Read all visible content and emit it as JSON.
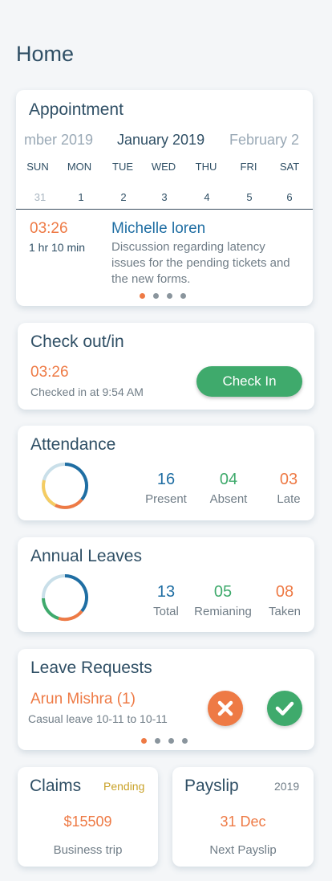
{
  "page": {
    "title": "Home"
  },
  "appointment": {
    "title": "Appointment",
    "months": {
      "prev": "mber 2019",
      "current": "January 2019",
      "next": "February 2"
    },
    "weekdays": [
      "SUN",
      "MON",
      "TUE",
      "WED",
      "THU",
      "FRI",
      "SAT"
    ],
    "dates": [
      "31",
      "1",
      "2",
      "3",
      "4",
      "5",
      "6"
    ],
    "time": "03:26",
    "duration": "1 hr 10 min",
    "person": "Michelle loren",
    "description": "Discussion regarding latency issues for the pending tickets and the new forms.",
    "pager": {
      "count": 4,
      "active": 0
    }
  },
  "checkin": {
    "title": "Check out/in",
    "time": "03:26",
    "subtitle": "Checked in at 9:54 AM",
    "button_label": "Check In"
  },
  "attendance": {
    "title": "Attendance",
    "stats": [
      {
        "value": "16",
        "label": "Present",
        "color": "#1f6ea3"
      },
      {
        "value": "04",
        "label": "Absent",
        "color": "#3faa6c"
      },
      {
        "value": "03",
        "label": "Late",
        "color": "#ee7a45"
      }
    ]
  },
  "annual_leaves": {
    "title": "Annual Leaves",
    "stats": [
      {
        "value": "13",
        "label": "Total",
        "color": "#1f6ea3"
      },
      {
        "value": "05",
        "label": "Remianing",
        "color": "#3faa6c"
      },
      {
        "value": "08",
        "label": "Taken",
        "color": "#ee7a45"
      }
    ]
  },
  "leave_requests": {
    "title": "Leave Requests",
    "name": "Arun Mishra (1)",
    "subtitle": "Casual leave 10-11 to 10-11",
    "reject_icon": "close-icon",
    "approve_icon": "check-icon",
    "pager": {
      "count": 4,
      "active": 0
    }
  },
  "claims": {
    "title": "Claims",
    "status": "Pending",
    "amount": "$15509",
    "label": "Business trip"
  },
  "payslip": {
    "title": "Payslip",
    "year": "2019",
    "date": "31 Dec",
    "label": "Next Payslip"
  },
  "colors": {
    "accent_orange": "#ee7a45",
    "accent_green": "#3faa6c",
    "accent_blue": "#1f6ea3",
    "text_dark": "#2f4f65",
    "pending": "#c9a228"
  }
}
